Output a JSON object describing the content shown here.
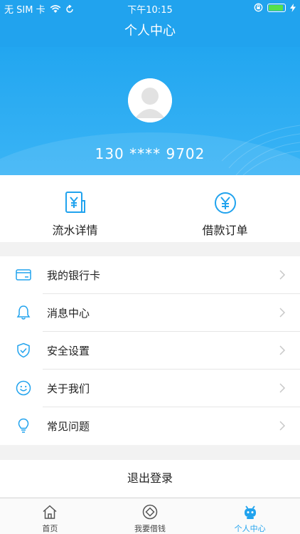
{
  "status_bar": {
    "carrier": "无 SIM 卡",
    "time": "下午10:15",
    "battery_percent": 90
  },
  "nav": {
    "title": "个人中心"
  },
  "profile": {
    "phone": "130 **** 9702"
  },
  "quick_actions": [
    {
      "label": "流水详情",
      "icon": "receipt-yen-icon"
    },
    {
      "label": "借款订单",
      "icon": "yen-circle-icon"
    }
  ],
  "menu": [
    {
      "label": "我的银行卡",
      "icon": "bank-card-icon"
    },
    {
      "label": "消息中心",
      "icon": "bell-icon"
    },
    {
      "label": "安全设置",
      "icon": "shield-icon"
    },
    {
      "label": "关于我们",
      "icon": "smiley-icon"
    },
    {
      "label": "常见问题",
      "icon": "lightbulb-icon"
    }
  ],
  "logout_label": "退出登录",
  "tabbar": [
    {
      "label": "首页",
      "icon": "home-icon",
      "active": false
    },
    {
      "label": "我要借钱",
      "icon": "yen-coin-icon",
      "active": false
    },
    {
      "label": "个人中心",
      "icon": "user-robot-icon",
      "active": true
    }
  ],
  "colors": {
    "primary": "#21a3ee",
    "text": "#222222",
    "background": "#f2f2f2"
  }
}
